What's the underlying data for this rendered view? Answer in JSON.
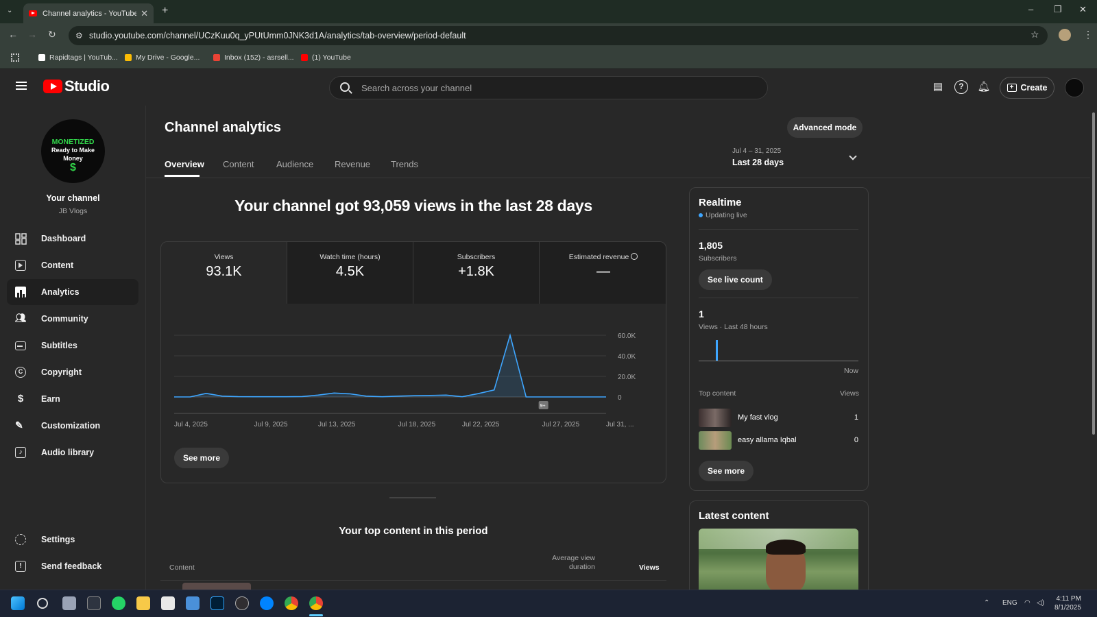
{
  "browser": {
    "tab_title": "Channel analytics - YouTube St",
    "url": "studio.youtube.com/channel/UCzKuu0q_yPUtUmm0JNK3d1A/analytics/tab-overview/period-default",
    "bookmarks": [
      {
        "label": "Rapidtags | YouTub...",
        "color": "#ffffff"
      },
      {
        "label": "My Drive - Google...",
        "color": "#fbbc04"
      },
      {
        "label": "Inbox (152) - asrsell...",
        "color": "#ea4335"
      },
      {
        "label": "(1) YouTube",
        "color": "#ff0000"
      }
    ]
  },
  "header": {
    "logo_text": "Studio",
    "search_placeholder": "Search across your channel",
    "create_label": "Create"
  },
  "sidebar": {
    "avatar_line1": "MONETIZED",
    "avatar_line2": "Ready to Make",
    "avatar_line3": "Money",
    "avatar_symbol": "$",
    "your_channel": "Your channel",
    "channel_name": "JB Vlogs",
    "items": [
      {
        "label": "Dashboard",
        "icon": "dashboard-icon"
      },
      {
        "label": "Content",
        "icon": "content-icon"
      },
      {
        "label": "Analytics",
        "icon": "analytics-icon"
      },
      {
        "label": "Community",
        "icon": "community-icon"
      },
      {
        "label": "Subtitles",
        "icon": "subtitles-icon"
      },
      {
        "label": "Copyright",
        "icon": "copyright-icon"
      },
      {
        "label": "Earn",
        "icon": "earn-icon"
      },
      {
        "label": "Customization",
        "icon": "customization-icon"
      },
      {
        "label": "Audio library",
        "icon": "audio-library-icon"
      }
    ],
    "settings": "Settings",
    "feedback": "Send feedback"
  },
  "main": {
    "title": "Channel analytics",
    "advanced_mode": "Advanced mode",
    "tabs": [
      "Overview",
      "Content",
      "Audience",
      "Revenue",
      "Trends"
    ],
    "date_range": "Jul 4 – 31, 2025",
    "date_label": "Last 28 days",
    "headline": "Your channel got 93,059 views in the last 28 days",
    "metrics": [
      {
        "label": "Views",
        "value": "93.1K"
      },
      {
        "label": "Watch time (hours)",
        "value": "4.5K"
      },
      {
        "label": "Subscribers",
        "value": "+1.8K"
      },
      {
        "label": "Estimated revenue",
        "value": "—"
      }
    ],
    "see_more": "See more",
    "top_content_title": "Your top content in this period",
    "table_headers": {
      "content": "Content",
      "avg_view_line1": "Average view",
      "avg_view_line2": "duration",
      "views": "Views"
    },
    "marker_badge": "9+"
  },
  "chart_data": {
    "type": "line",
    "x": [
      "Jul 4",
      "Jul 5",
      "Jul 6",
      "Jul 7",
      "Jul 8",
      "Jul 9",
      "Jul 10",
      "Jul 11",
      "Jul 12",
      "Jul 13",
      "Jul 14",
      "Jul 15",
      "Jul 16",
      "Jul 17",
      "Jul 18",
      "Jul 19",
      "Jul 20",
      "Jul 21",
      "Jul 22",
      "Jul 23",
      "Jul 24",
      "Jul 25",
      "Jul 26",
      "Jul 27",
      "Jul 28",
      "Jul 29",
      "Jul 30",
      "Jul 31"
    ],
    "values": [
      0,
      0,
      3500,
      800,
      300,
      200,
      200,
      200,
      400,
      1800,
      3800,
      3000,
      800,
      200,
      800,
      1200,
      1500,
      1800,
      200,
      3200,
      6800,
      60000,
      0,
      0,
      0,
      0,
      0,
      0
    ],
    "x_tick_labels": [
      "Jul 4, 2025",
      "Jul 9, 2025",
      "Jul 13, 2025",
      "Jul 18, 2025",
      "Jul 22, 2025",
      "Jul 27, 2025",
      "Jul 31, ..."
    ],
    "y_tick_labels": [
      "60.0K",
      "40.0K",
      "20.0K",
      "0"
    ],
    "ylim": [
      0,
      60000
    ],
    "grid": true,
    "line_color": "#3ea6ff"
  },
  "realtime": {
    "title": "Realtime",
    "status": "Updating live",
    "subscribers_value": "1,805",
    "subscribers_label": "Subscribers",
    "see_live_count": "See live count",
    "views_value": "1",
    "views_label": "Views · Last 48 hours",
    "now_label": "Now",
    "top_content_label": "Top content",
    "views_col": "Views",
    "items": [
      {
        "title": "My fast vlog",
        "views": "1"
      },
      {
        "title": "easy allama Iqbal",
        "views": "0"
      }
    ],
    "see_more": "See more"
  },
  "latest": {
    "title": "Latest content"
  },
  "taskbar": {
    "lang": "ENG",
    "time": "4:11 PM",
    "date": "8/1/2025"
  }
}
